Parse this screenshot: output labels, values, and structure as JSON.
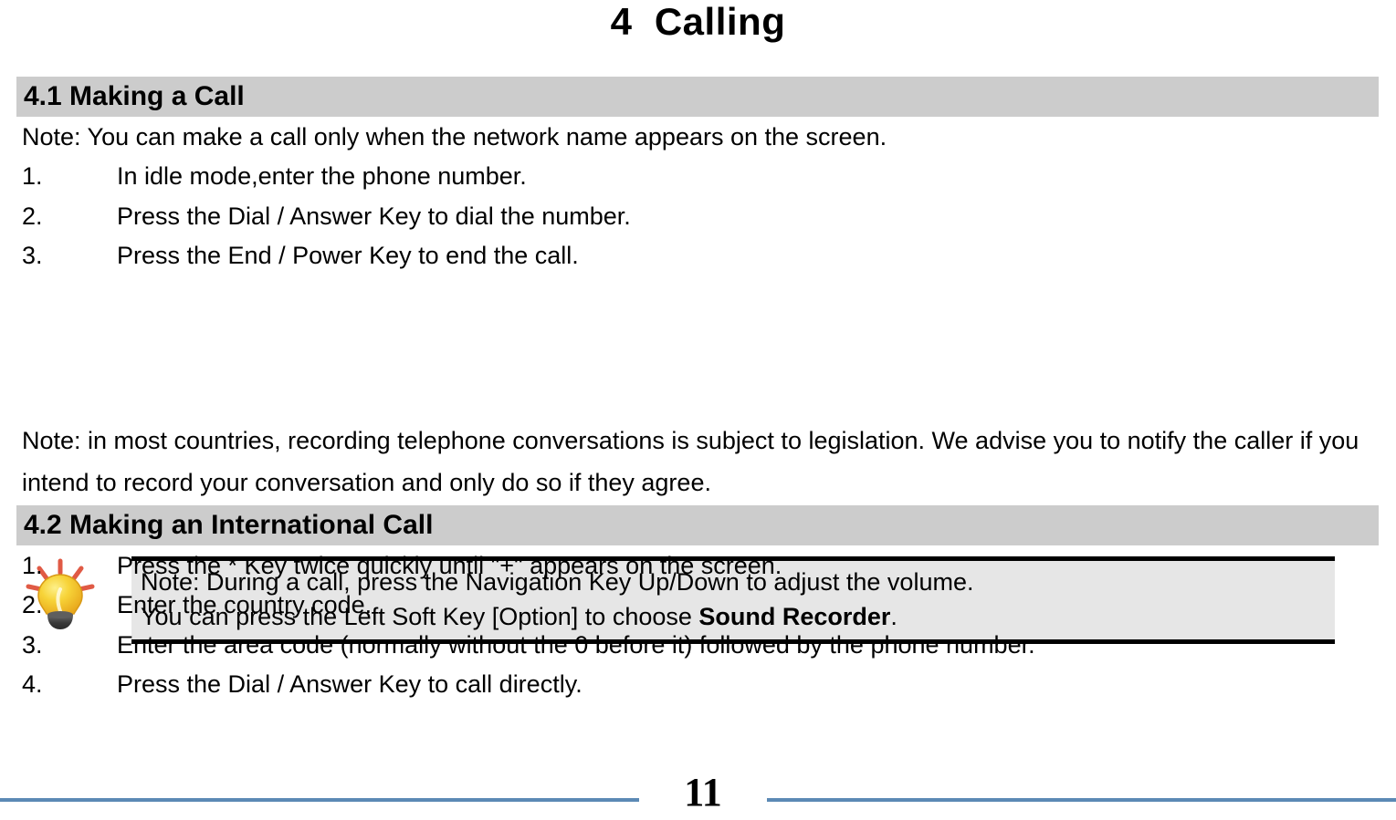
{
  "document": {
    "chapter_title": "4  Calling",
    "page_number": "11",
    "accent_color": "#5b89b5",
    "header_bar_color": "#cccccc",
    "note_box_color": "#e6e6e6"
  },
  "sections": [
    {
      "heading": "4.1 Making a Call",
      "intro": "Note: You can make a call only when the network name appears on the screen.",
      "steps": [
        {
          "number": "1.",
          "text": "In idle mode,enter the phone number."
        },
        {
          "number": "2.",
          "text": "Press the Dial / Answer Key to dial the number."
        },
        {
          "number": "3.",
          "text": "Press the End / Power Key to end the call."
        }
      ]
    },
    {
      "heading": "4.2 Making an International Call",
      "steps": [
        {
          "number": "1.",
          "text": "Press the * Key twice quickly until \"+\" appears on the screen."
        },
        {
          "number": "2.",
          "text": "Enter the country code."
        },
        {
          "number": "3.",
          "text": "Enter the area code (normally without the 0 before it) followed by the phone number."
        },
        {
          "number": "4.",
          "text": "Press the Dial / Answer Key to call directly."
        }
      ]
    }
  ],
  "tip_note": {
    "icon": "lightbulb-icon",
    "line1": "Note: During a call, press the Navigation Key Up/Down to adjust the volume.",
    "line2_prefix": "You can press the Left Soft Key [Option] to choose ",
    "line2_bold": "Sound Recorder",
    "line2_suffix": "."
  },
  "legal_note": "Note: in most countries, recording telephone conversations is subject to legislation. We advise you to notify the caller if you intend to record your conversation and only do so if they agree."
}
